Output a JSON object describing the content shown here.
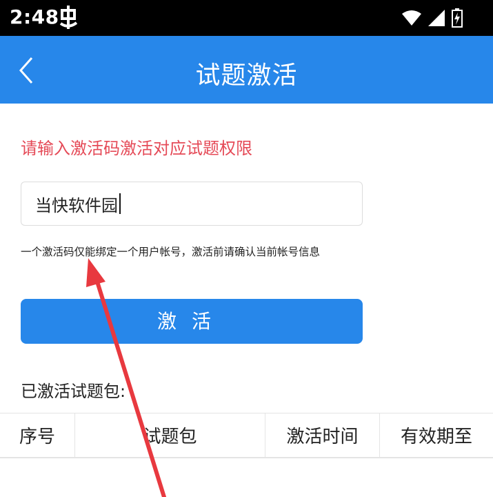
{
  "status_bar": {
    "time": "2:48"
  },
  "header": {
    "title": "试题激活"
  },
  "form": {
    "prompt": "请输入激活码激活对应试题权限",
    "code_value": "当快软件园",
    "hint": "一个激活码仅能绑定一个用户帐号，激活前请确认当前帐号信息",
    "activate_label": "激活"
  },
  "activated": {
    "label": "已激活试题包:",
    "columns": [
      "序号",
      "试题包",
      "激活时间",
      "有效期至"
    ]
  },
  "colors": {
    "accent": "#2787ea",
    "prompt": "#e54a57",
    "annotation": "#e8393f"
  }
}
